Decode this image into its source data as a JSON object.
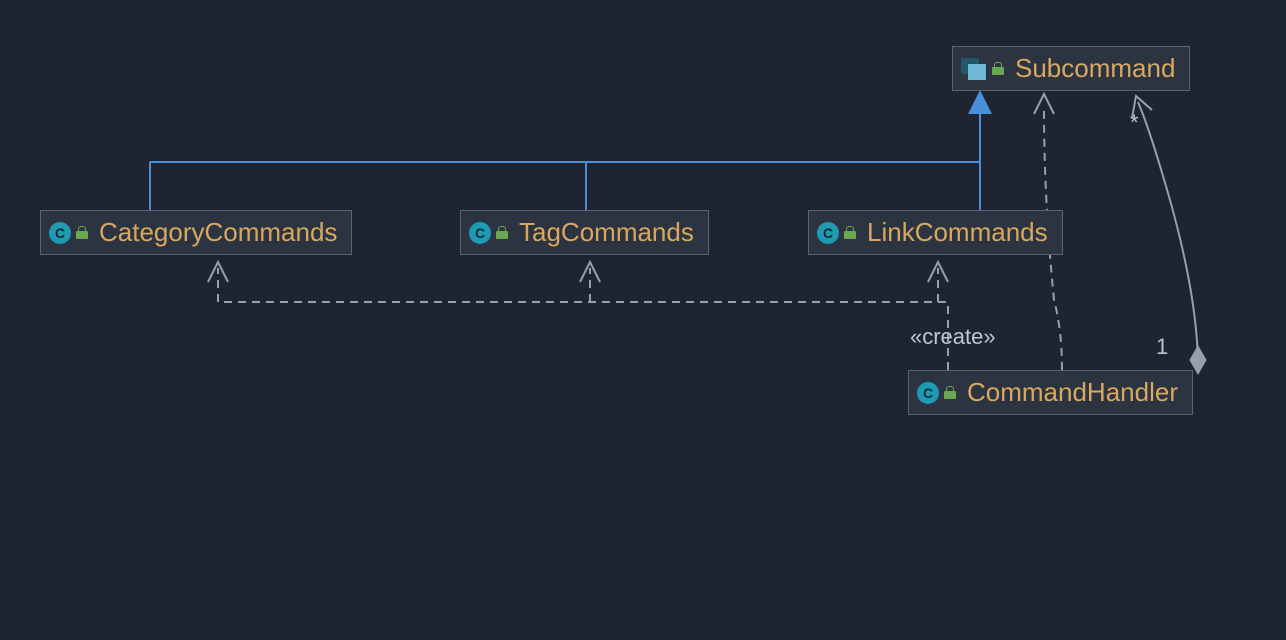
{
  "classes": {
    "subcommand": {
      "name": "Subcommand",
      "kind": "interface"
    },
    "category": {
      "name": "CategoryCommands",
      "kind": "class"
    },
    "tag": {
      "name": "TagCommands",
      "kind": "class"
    },
    "link": {
      "name": "LinkCommands",
      "kind": "class"
    },
    "handler": {
      "name": "CommandHandler",
      "kind": "class"
    }
  },
  "labels": {
    "create": "«create»",
    "star": "*",
    "one": "1"
  },
  "relationships": [
    {
      "from": "CategoryCommands",
      "to": "Subcommand",
      "type": "realization"
    },
    {
      "from": "TagCommands",
      "to": "Subcommand",
      "type": "realization"
    },
    {
      "from": "LinkCommands",
      "to": "Subcommand",
      "type": "realization"
    },
    {
      "from": "CommandHandler",
      "to": "CategoryCommands",
      "type": "create-dependency"
    },
    {
      "from": "CommandHandler",
      "to": "TagCommands",
      "type": "create-dependency"
    },
    {
      "from": "CommandHandler",
      "to": "LinkCommands",
      "type": "create-dependency"
    },
    {
      "from": "CommandHandler",
      "to": "Subcommand",
      "type": "create-dependency"
    },
    {
      "from": "CommandHandler",
      "to": "Subcommand",
      "type": "aggregation",
      "from_mult": "1",
      "to_mult": "*"
    }
  ],
  "colors": {
    "background": "#1e2430",
    "node_bg": "#2b3440",
    "node_border": "#5a6470",
    "text": "#d9a860",
    "realization": "#4a90d9",
    "dependency": "#96a0ac"
  }
}
